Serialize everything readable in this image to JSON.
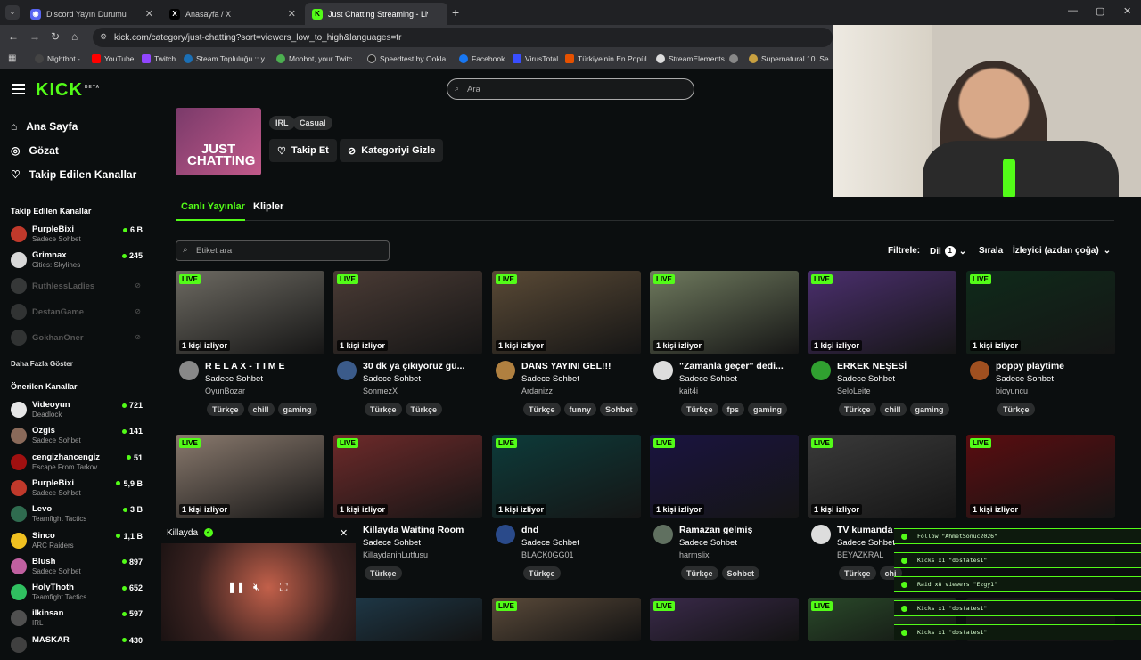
{
  "browser": {
    "tabs": [
      {
        "title": "Discord Yayın Durumu",
        "active": false
      },
      {
        "title": "Anasayfa / X",
        "active": false
      },
      {
        "title": "Just Chatting Streaming - Live",
        "active": true
      }
    ],
    "url": "kick.com/category/just-chatting?sort=viewers_low_to_high&languages=tr",
    "bookmarks": [
      "Nightbot -",
      "YouTube",
      "Twitch",
      "Steam Topluluğu :: y...",
      "Moobot, your Twitc...",
      "Speedtest by Ookla...",
      "Facebook",
      "VirusTotal",
      "Türkiye'nin En Popül...",
      "StreamElements",
      "",
      "Supernatural 10. Se..."
    ]
  },
  "colors": {
    "accent": "#53fc18",
    "bg": "#0b0e0f"
  },
  "search": {
    "placeholder": "Ara"
  },
  "nav": [
    "Ana Sayfa",
    "Gözat",
    "Takip Edilen Kanallar"
  ],
  "followed": {
    "heading": "Takip Edilen Kanallar",
    "items": [
      {
        "name": "PurpleBixi",
        "sub": "Sadece Sohbet",
        "viewers": "6 B",
        "color": "#c0392b"
      },
      {
        "name": "Grimnax",
        "sub": "Cities: Skylines",
        "viewers": "245",
        "color": "#d8d8d8"
      },
      {
        "name": "RuthlessLadies",
        "sub": "",
        "viewers": "",
        "color": "#888"
      },
      {
        "name": "DestanGame",
        "sub": "",
        "viewers": "",
        "color": "#777"
      },
      {
        "name": "GokhanOner",
        "sub": "",
        "viewers": "",
        "color": "#777"
      }
    ],
    "more": "Daha Fazla Göster"
  },
  "recommended": {
    "heading": "Önerilen Kanallar",
    "items": [
      {
        "name": "Videoyun",
        "sub": "Deadlock",
        "viewers": "721",
        "color": "#e6e6e6"
      },
      {
        "name": "Ozgis",
        "sub": "Sadece Sohbet",
        "viewers": "141",
        "color": "#8a6a5a"
      },
      {
        "name": "cengizhancengiz",
        "sub": "Escape From Tarkov",
        "viewers": "51",
        "color": "#a01010"
      },
      {
        "name": "PurpleBixi",
        "sub": "Sadece Sohbet",
        "viewers": "5,9 B",
        "color": "#c0392b"
      },
      {
        "name": "Levo",
        "sub": "Teamfight Tactics",
        "viewers": "3 B",
        "color": "#2f6b4f"
      },
      {
        "name": "Sinco",
        "sub": "ARC Raiders",
        "viewers": "1,1 B",
        "color": "#f0c020"
      },
      {
        "name": "Blush",
        "sub": "Sadece Sohbet",
        "viewers": "897",
        "color": "#c060a0"
      },
      {
        "name": "HolyThoth",
        "sub": "Teamfight Tactics",
        "viewers": "652",
        "color": "#30c060"
      },
      {
        "name": "ilkinsan",
        "sub": "IRL",
        "viewers": "597",
        "color": "#505050"
      },
      {
        "name": "MASKAR",
        "sub": "",
        "viewers": "430",
        "color": "#404040"
      }
    ]
  },
  "category": {
    "thumb_text": "JUST CHATTING",
    "pills": [
      "IRL",
      "Casual"
    ],
    "follow": "Takip Et",
    "hide": "Kategoriyi Gizle",
    "tab_live": "Canlı Yayınlar",
    "tab_clips": "Klipler"
  },
  "filters": {
    "tag_placeholder": "Etiket ara",
    "filter_label": "Filtrele:",
    "lang": "Dil",
    "lang_count": "1",
    "sort_label": "Sırala",
    "sort_value": "İzleyici (azdan çoğa)"
  },
  "live_label": "LIVE",
  "streams": [
    {
      "title": "R E L A X - T I M E",
      "category": "Sadece Sohbet",
      "streamer": "OyunBozar",
      "viewers": "1 kişi izliyor",
      "tags": [
        "Türkçe",
        "chill",
        "gaming"
      ],
      "thumb": "#6d6a62",
      "avatar": "#888"
    },
    {
      "title": "30 dk ya çıkıyoruz gü...",
      "category": "Sadece Sohbet",
      "streamer": "SonmezX",
      "viewers": "1 kişi izliyor",
      "tags": [
        "Türkçe",
        "Türkçe"
      ],
      "thumb": "#4a3b35",
      "avatar": "#3b5b8a"
    },
    {
      "title": "DANS YAYINI GEL!!!",
      "category": "Sadece Sohbet",
      "streamer": "Ardanizz",
      "viewers": "1 kişi izliyor",
      "tags": [
        "Türkçe",
        "funny",
        "Sohbet"
      ],
      "thumb": "#5a4a36",
      "avatar": "#b08040"
    },
    {
      "title": "\"Zamanla geçer\" dedi...",
      "category": "Sadece Sohbet",
      "streamer": "kait4i",
      "viewers": "1 kişi izliyor",
      "tags": [
        "Türkçe",
        "fps",
        "gaming"
      ],
      "thumb": "#6f7a5e",
      "avatar": "#ddd"
    },
    {
      "title": "ERKEK NEŞESİ",
      "category": "Sadece Sohbet",
      "streamer": "SeloLeite",
      "viewers": "1 kişi izliyor",
      "tags": [
        "Türkçe",
        "chill",
        "gaming"
      ],
      "thumb": "#4b2f6e",
      "avatar": "#30a030"
    },
    {
      "title": "poppy playtime",
      "category": "Sadece Sohbet",
      "streamer": "bioyuncu",
      "viewers": "1 kişi izliyor",
      "tags": [
        "Türkçe"
      ],
      "thumb": "#0f2a1a",
      "avatar": "#a05020"
    },
    {
      "title": "",
      "category": "",
      "streamer": "",
      "viewers": "1 kişi izliyor",
      "tags": [],
      "thumb": "#8a7a6e",
      "avatar": ""
    },
    {
      "title": "Killayda Waiting Room",
      "category": "Sadece Sohbet",
      "streamer": "KillaydaninLutfusu",
      "viewers": "1 kişi izliyor",
      "tags": [
        "Türkçe"
      ],
      "thumb": "#6e2a2a",
      "avatar": ""
    },
    {
      "title": "dnd",
      "category": "Sadece Sohbet",
      "streamer": "BLACK0GG01",
      "viewers": "1 kişi izliyor",
      "tags": [
        "Türkçe"
      ],
      "thumb": "#0d3b3a",
      "avatar": "#2a4a8a"
    },
    {
      "title": "Ramazan gelmiş",
      "category": "Sadece Sohbet",
      "streamer": "harmslix",
      "viewers": "1 kişi izliyor",
      "tags": [
        "Türkçe",
        "Sohbet"
      ],
      "thumb": "#1a1440",
      "avatar": "#607060"
    },
    {
      "title": "TV kumanda",
      "category": "Sadece Sohbet",
      "streamer": "BEYAZKRAL",
      "viewers": "1 kişi izliyor",
      "tags": [
        "Türkçe",
        "chi"
      ],
      "thumb": "#3a3a3a",
      "avatar": "#ddd"
    },
    {
      "title": "",
      "category": "",
      "streamer": "",
      "viewers": "1 kişi izliyor",
      "tags": [],
      "thumb": "#5a0d10",
      "avatar": ""
    }
  ],
  "mini_player": {
    "name": "Killayda"
  },
  "overlay_alerts": [
    "Follow \"AhmetSonuc2026\"",
    "Kicks x1 \"dostates1\"",
    "Raid x8 viewers \"Ezgy1\"",
    "Kicks x1 \"dostates1\"",
    "Kicks x1 \"dostates1\""
  ]
}
